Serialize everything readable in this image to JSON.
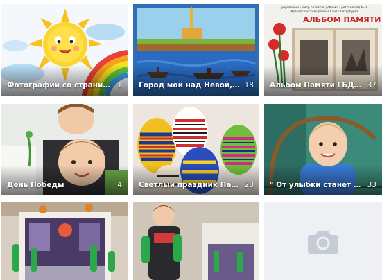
{
  "albums": [
    {
      "title": "Фотографии со страницы сообщ...",
      "count": "1"
    },
    {
      "title": "Город мой над Невой, в мире т...",
      "count": "18"
    },
    {
      "title": "Альбом Памяти ГБДОУ ЦРР - де...",
      "count": "37"
    },
    {
      "title": "День Победы",
      "count": "4"
    },
    {
      "title": "Светлый праздник Пасхи!Вербн...",
      "count": "28"
    },
    {
      "title": "\" От улыбки станет всем светлей\"",
      "count": "33"
    },
    {
      "title": "",
      "count": ""
    },
    {
      "title": "",
      "count": ""
    }
  ],
  "empty_tile": {
    "icon": "camera-icon"
  },
  "album3_header": {
    "line1": "управление центр развития ребенка - детский сад №38",
    "line2": "Красносельского района Санкт-Петербурга",
    "heading": "АЛЬБОМ ПАМЯТИ"
  },
  "colors": {
    "placeholder_bg": "#eef0f3",
    "placeholder_icon": "#c5ccd6"
  }
}
